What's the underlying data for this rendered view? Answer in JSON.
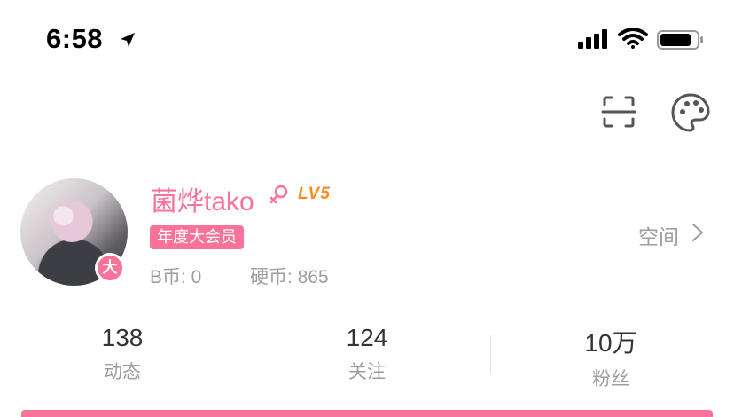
{
  "status_bar": {
    "time": "6:58"
  },
  "profile": {
    "username": "菌烨tako",
    "level": "LV5",
    "vip_tag": "年度大会员",
    "vip_badge_glyph": "大",
    "b_coins": "B币: 0",
    "hard_coins": "硬币: 865",
    "space_link": "空间"
  },
  "stats": [
    {
      "value": "138",
      "label": "动态"
    },
    {
      "value": "124",
      "label": "关注"
    },
    {
      "value": "10万",
      "label": "粉丝"
    }
  ],
  "colors": {
    "accent": "#fb7299",
    "level": "#ff8a1f",
    "muted": "#9e9e9e"
  },
  "icons": [
    "location-arrow-icon",
    "signal-icon",
    "wifi-icon",
    "battery-icon",
    "scan-icon",
    "palette-icon",
    "female-icon",
    "chevron-right-icon"
  ]
}
